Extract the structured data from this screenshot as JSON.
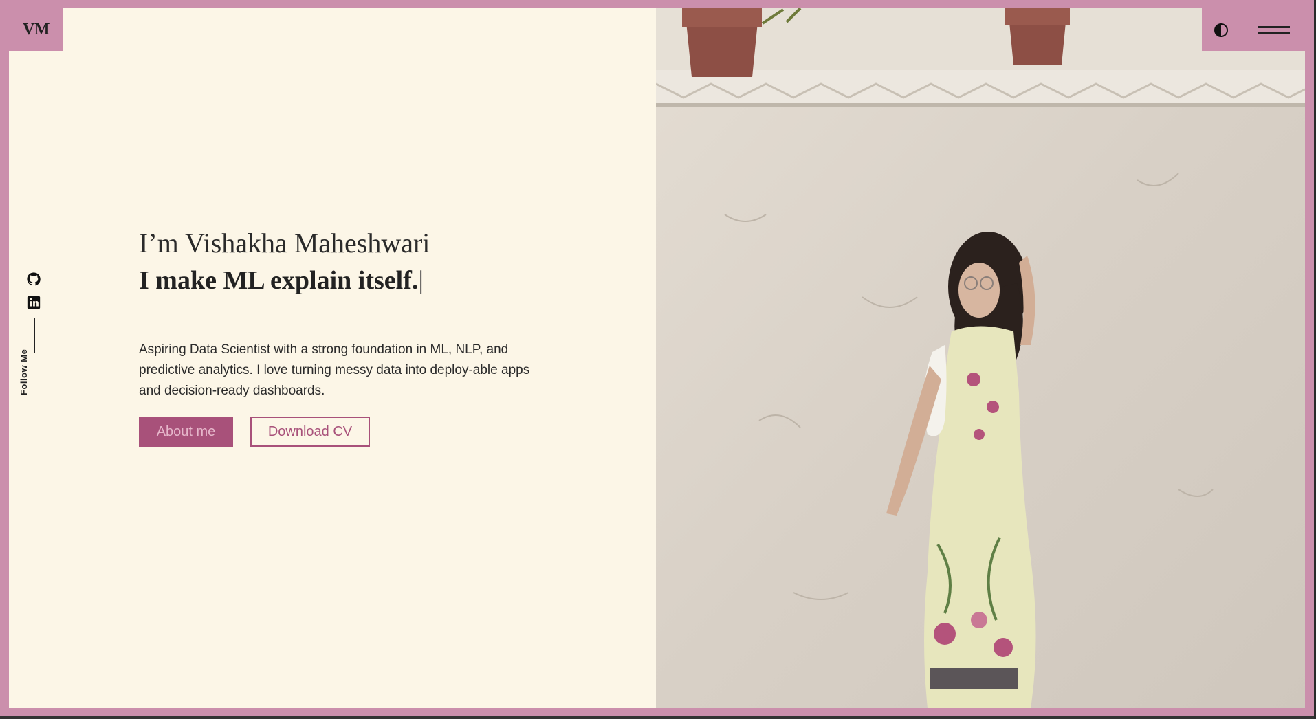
{
  "brand": {
    "logo": "VM"
  },
  "header": {
    "theme_toggle_icon": "contrast-icon",
    "menu_icon": "hamburger-icon"
  },
  "social": {
    "icons": [
      "github-icon",
      "linkedin-icon"
    ],
    "label": "Follow Me"
  },
  "hero": {
    "greeting": "I’m Vishakha Maheshwari",
    "tagline": "I make ML explain itself.",
    "caret": "|",
    "description": "Aspiring Data Scientist with a strong foundation in ML, NLP, and predictive analytics. I love turning messy data into deploy-able apps and decision-ready dashboards.",
    "primary_button": "About me",
    "secondary_button": "Download CV"
  },
  "colors": {
    "accent": "#cb8fac",
    "button": "#a8517a",
    "background": "#fcf6e7"
  }
}
